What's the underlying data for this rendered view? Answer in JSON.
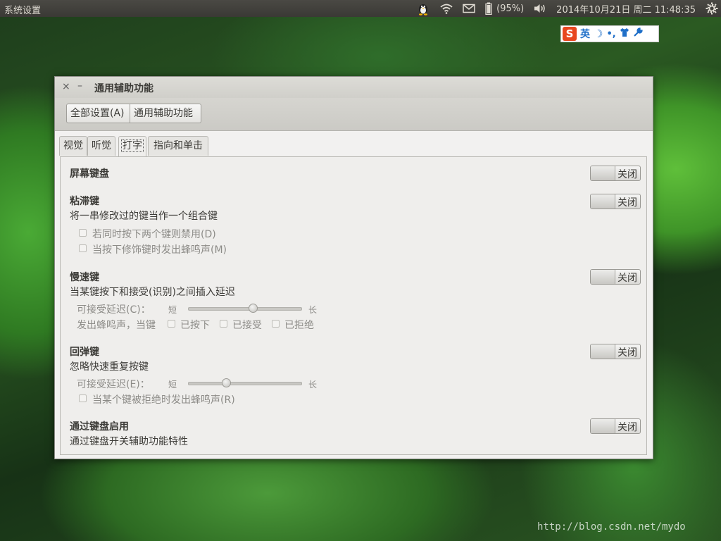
{
  "top_panel": {
    "app_title": "系统设置",
    "battery": "(95%)",
    "datetime": "2014年10月21日 周二 11:48:35"
  },
  "ime_bar": {
    "logo": "S",
    "mode": "英",
    "moon": "☽",
    "punct": "•,",
    "shirt": "👕",
    "tool": "🔧"
  },
  "dialog": {
    "close": "×",
    "minimize": "–",
    "title": "通用辅助功能",
    "breadcrumb": {
      "all_settings": "全部设置(A)",
      "current": "通用辅助功能"
    },
    "tabs": [
      {
        "label": "视觉"
      },
      {
        "label": "听觉"
      },
      {
        "label": "打字"
      },
      {
        "label": "指向和单击"
      }
    ],
    "typing": {
      "onscreen_keyboard": {
        "title": "屏幕键盘",
        "toggle": "关闭"
      },
      "sticky_keys": {
        "title": "粘滞键",
        "desc": "将一串修改过的键当作一个组合键",
        "toggle": "关闭",
        "opt1": "若同时按下两个键则禁用(D)",
        "opt2": "当按下修饰键时发出蜂鸣声(M)"
      },
      "slow_keys": {
        "title": "慢速键",
        "desc": "当某键按下和接受(识别)之间插入延迟",
        "toggle": "关闭",
        "delay_label": "可接受延迟(C)：",
        "short": "短",
        "long": "长",
        "delay_value": 0.58,
        "beep_label": "发出蜂鸣声，当键",
        "beep_pressed": "已按下",
        "beep_accepted": "已接受",
        "beep_rejected": "已拒绝"
      },
      "bounce_keys": {
        "title": "回弹键",
        "desc": "忽略快速重复按键",
        "toggle": "关闭",
        "delay_label": "可接受延迟(E)：",
        "short": "短",
        "long": "长",
        "delay_value": 0.34,
        "opt1": "当某个键被拒绝时发出蜂鸣声(R)"
      },
      "enable_by_keyboard": {
        "title": "通过键盘启用",
        "desc": "通过键盘开关辅助功能特性",
        "toggle": "关闭"
      }
    }
  },
  "watermark": "http://blog.csdn.net/mydo",
  "colors": {
    "panel_bg": "#3c3b37",
    "dialog_bg": "#f2f1f0",
    "ime_logo": "#e8461f",
    "ime_accent": "#1f6fc8"
  }
}
